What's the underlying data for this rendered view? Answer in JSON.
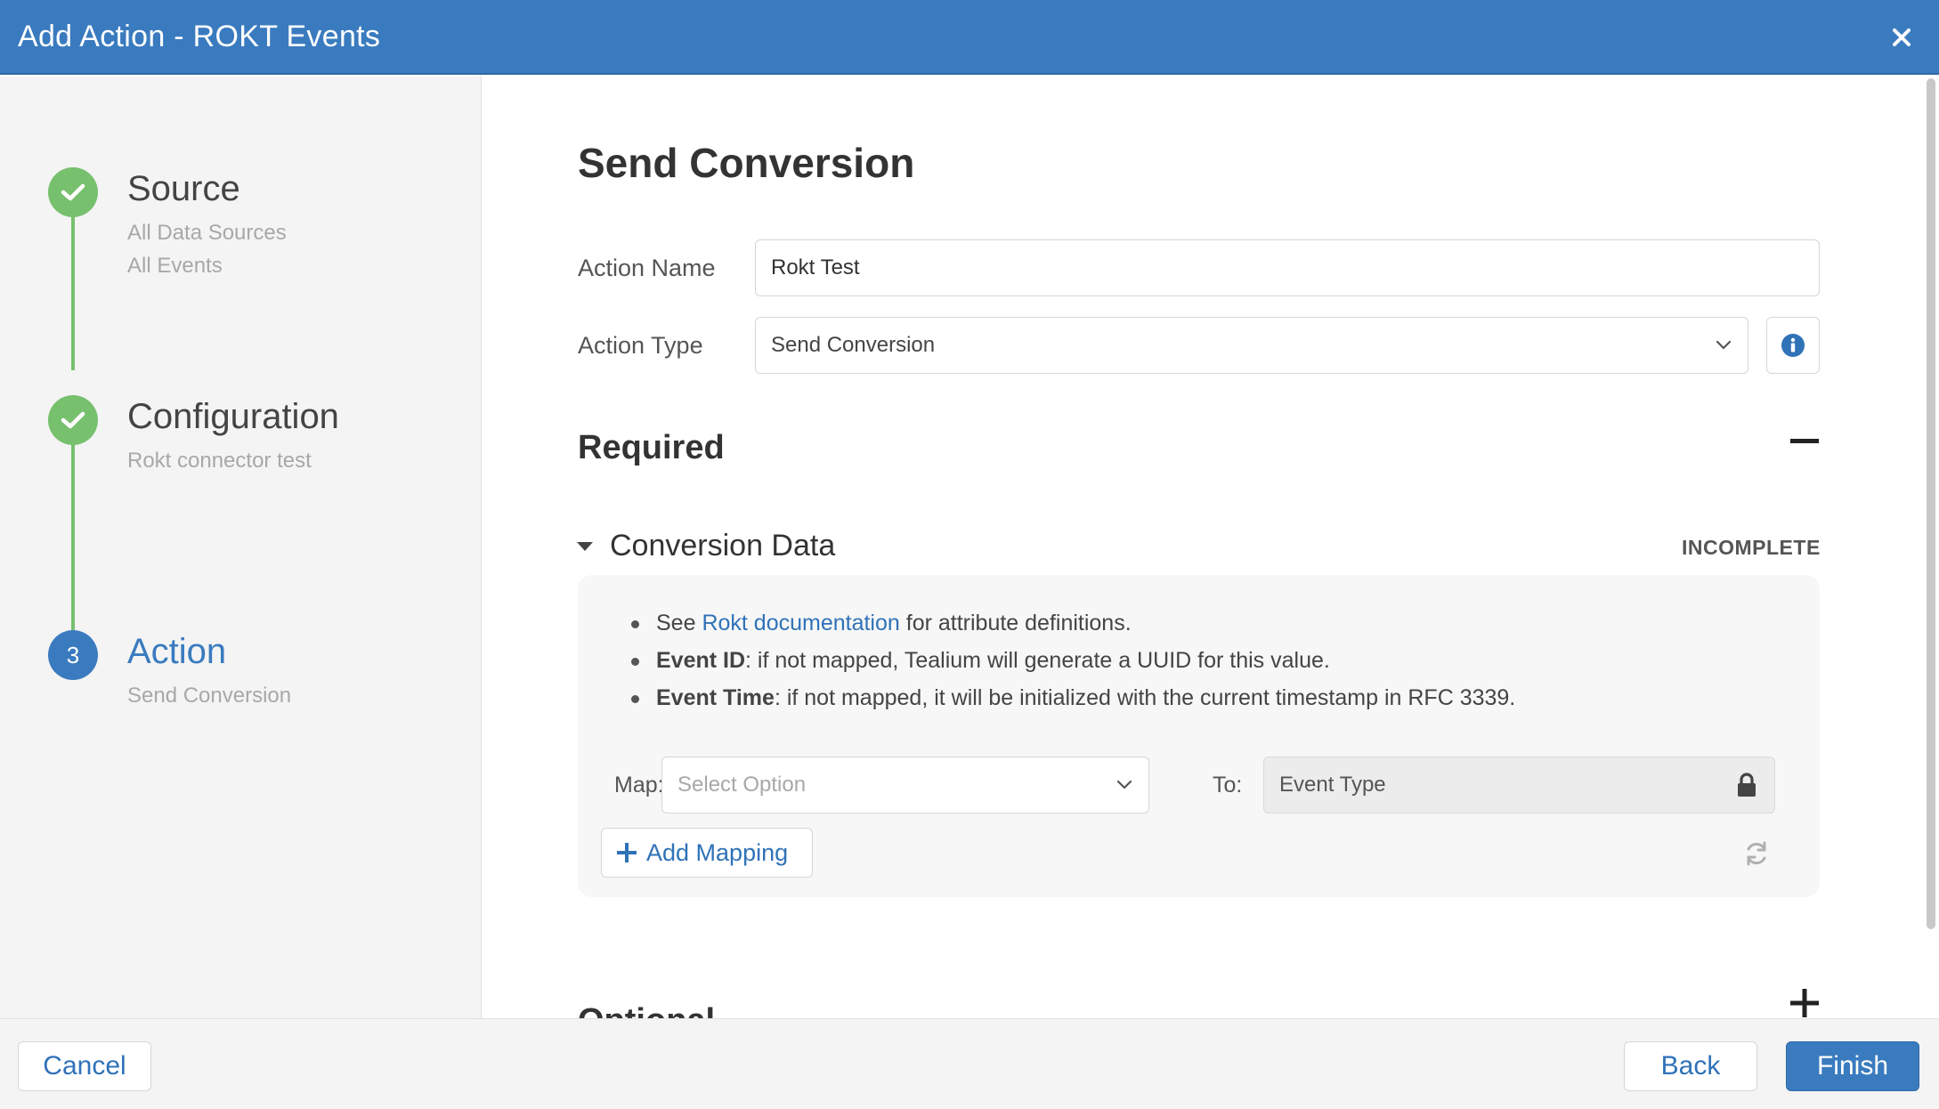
{
  "window": {
    "title": "Add Action - ROKT Events"
  },
  "steps": [
    {
      "number": "",
      "title": "Source",
      "subtitles": [
        "All Data Sources",
        "All Events"
      ],
      "state": "done"
    },
    {
      "number": "",
      "title": "Configuration",
      "subtitles": [
        "Rokt connector test"
      ],
      "state": "done"
    },
    {
      "number": "3",
      "title": "Action",
      "subtitles": [
        "Send Conversion"
      ],
      "state": "active"
    }
  ],
  "main": {
    "title": "Send Conversion",
    "action_name": {
      "label": "Action Name",
      "value": "Rokt Test"
    },
    "action_type": {
      "label": "Action Type",
      "value": "Send Conversion"
    },
    "required": {
      "title": "Required"
    },
    "conversion_data": {
      "title": "Conversion Data",
      "status": "INCOMPLETE",
      "notes": {
        "n1_pre": "See ",
        "n1_link": "Rokt documentation",
        "n1_post": " for attribute definitions.",
        "n2_bold": "Event ID",
        "n2_rest": ": if not mapped, Tealium will generate a UUID for this value.",
        "n3_bold": "Event Time",
        "n3_rest": ": if not mapped, it will be initialized with the current timestamp in RFC 3339."
      },
      "map_label": "Map:",
      "map_placeholder": "Select Option",
      "to_label": "To:",
      "to_value": "Event Type",
      "add_mapping_label": "Add Mapping"
    },
    "optional": {
      "title": "Optional"
    }
  },
  "footer": {
    "cancel": "Cancel",
    "back": "Back",
    "finish": "Finish"
  },
  "colors": {
    "header": "#3a7bbf",
    "step_done": "#77c06e",
    "link": "#2f72b8",
    "primary": "#3a7bbf"
  }
}
